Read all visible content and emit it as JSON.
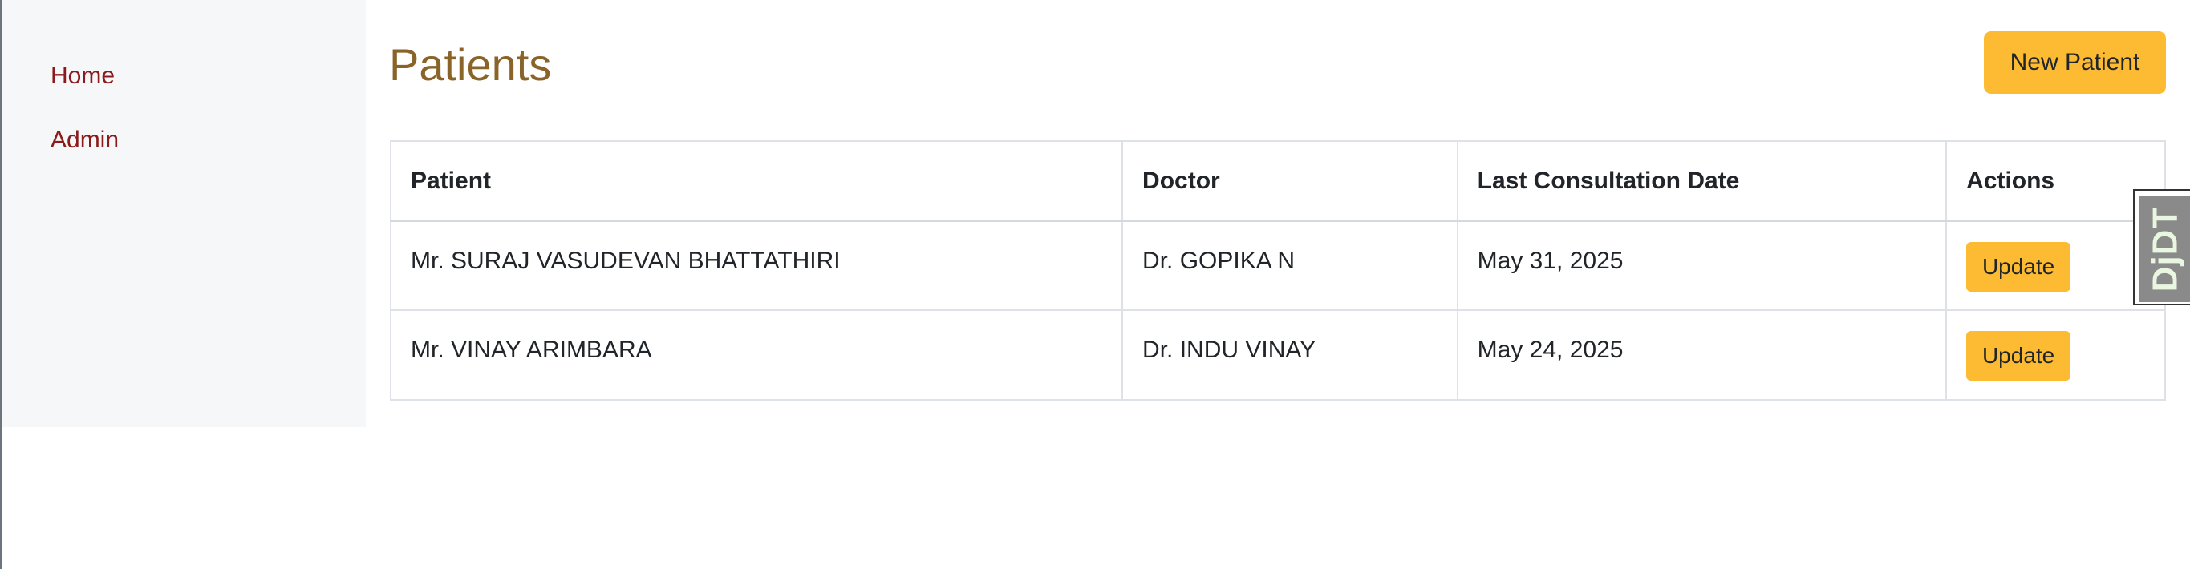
{
  "sidebar": {
    "items": [
      {
        "label": "Home"
      },
      {
        "label": "Admin"
      }
    ]
  },
  "header": {
    "title": "Patients",
    "new_button_label": "New Patient"
  },
  "table": {
    "columns": [
      "Patient",
      "Doctor",
      "Last Consultation Date",
      "Actions"
    ],
    "rows": [
      {
        "patient": "Mr. SURAJ VASUDEVAN BHATTATHIRI",
        "doctor": "Dr. GOPIKA N",
        "date": "May 31, 2025",
        "action": "Update"
      },
      {
        "patient": "Mr. VINAY ARIMBARA",
        "doctor": "Dr. INDU VINAY",
        "date": "May 24, 2025",
        "action": "Update"
      }
    ]
  },
  "debug_toolbar": {
    "label": "DjDT"
  },
  "colors": {
    "accent": "#fdbb34",
    "title": "#8a6328",
    "nav_link": "#8b1a1a",
    "sidebar_bg": "#f6f7f9"
  }
}
